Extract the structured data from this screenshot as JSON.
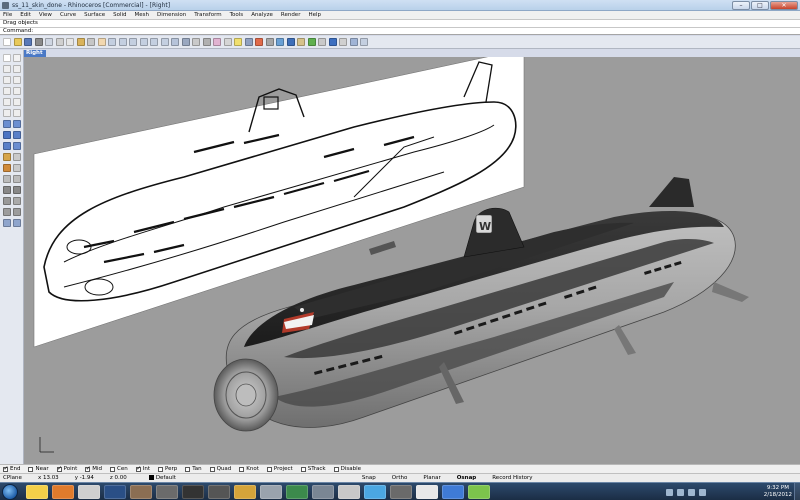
{
  "window": {
    "title": "ss_11_skin_done - Rhinoceros [Commercial] - [Right]",
    "buttons": {
      "minimize": "–",
      "maximize": "□",
      "close": "✕"
    },
    "app_icon": "rhino-icon"
  },
  "menu": [
    "File",
    "Edit",
    "View",
    "Curve",
    "Surface",
    "Solid",
    "Mesh",
    "Dimension",
    "Transform",
    "Tools",
    "Analyze",
    "Render",
    "Help"
  ],
  "command_history": "Drag objects",
  "command_prompt": "Command:",
  "viewport": {
    "label": "Right"
  },
  "osnaps": [
    {
      "label": "End",
      "checked": true
    },
    {
      "label": "Near",
      "checked": false
    },
    {
      "label": "Point",
      "checked": true
    },
    {
      "label": "Mid",
      "checked": true
    },
    {
      "label": "Cen",
      "checked": false
    },
    {
      "label": "Int",
      "checked": true
    },
    {
      "label": "Perp",
      "checked": false
    },
    {
      "label": "Tan",
      "checked": false
    },
    {
      "label": "Quad",
      "checked": false
    },
    {
      "label": "Knot",
      "checked": false
    },
    {
      "label": "Project",
      "checked": false
    },
    {
      "label": "STrack",
      "checked": false
    },
    {
      "label": "Disable",
      "checked": false
    }
  ],
  "status": {
    "cplane": "CPlane",
    "x": "x 13.03",
    "y": "y -1.94",
    "z": "z 0.00",
    "layer": "Default",
    "snap": "Snap",
    "ortho": "Ortho",
    "planar": "Planar",
    "osnap": "Osnap",
    "history": "Record History"
  },
  "clock": {
    "time": "9:32 PM",
    "date": "2/18/2012"
  },
  "colors": {
    "viewport_bg": "#9c9c9c",
    "tab_blue": "#4a79c6",
    "hull_dark": "#2a2a2a",
    "hull_light": "#a8a8a8"
  }
}
